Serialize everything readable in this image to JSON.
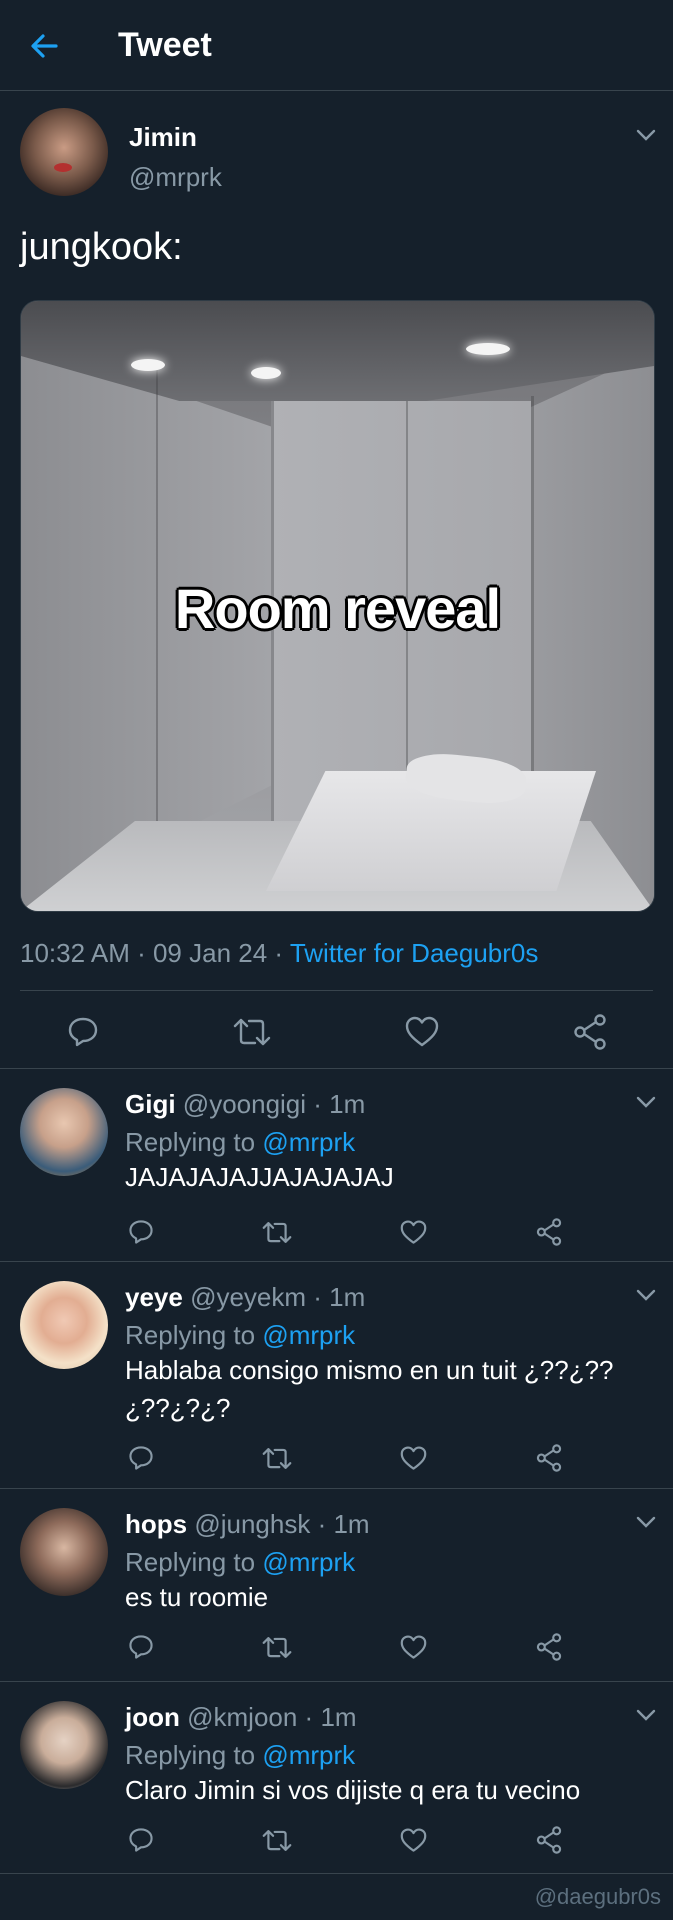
{
  "header": {
    "title": "Tweet",
    "back_icon": "arrow-left-icon"
  },
  "tweet": {
    "author_name": "Jimin",
    "author_handle": "@mrprk",
    "text": "jungkook:",
    "media_caption": "Room reveal",
    "time": "10:32 AM",
    "date": "09 Jan 24",
    "source": "Twitter for Daegubr0s",
    "separator": " · "
  },
  "replies": [
    {
      "name": "Gigi",
      "handle": "@yoongigi",
      "time": "1m",
      "replying_label": "Replying to",
      "replying_to": "@mrprk",
      "text": "JAJAJAJAJJAJAJAJAJ"
    },
    {
      "name": "yeye",
      "handle": "@yeyekm",
      "time": "1m",
      "replying_label": "Replying to",
      "replying_to": "@mrprk",
      "text": "Hablaba consigo mismo en un tuit ¿??¿??¿??¿?¿?"
    },
    {
      "name": "hops",
      "handle": "@junghsk",
      "time": "1m",
      "replying_label": "Replying to",
      "replying_to": "@mrprk",
      "text": "es tu roomie"
    },
    {
      "name": "joon",
      "handle": "@kmjoon",
      "time": "1m",
      "replying_label": "Replying to",
      "replying_to": "@mrprk",
      "text": "Claro Jimin si vos dijiste q era tu vecino"
    }
  ],
  "watermark": "@daegubr0s",
  "colors": {
    "background": "#15202b",
    "accent": "#1da1f2",
    "secondary_text": "#8899a6",
    "divider": "#38444d"
  }
}
